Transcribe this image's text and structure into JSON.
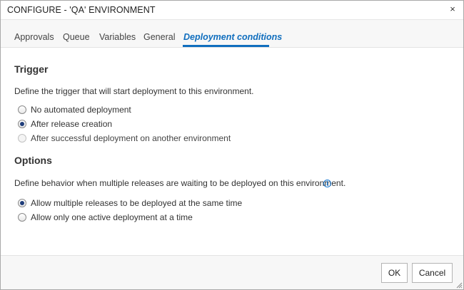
{
  "dialog": {
    "title": "CONFIGURE - 'QA' ENVIRONMENT",
    "close_glyph": "×"
  },
  "tabs": [
    {
      "label": "Approvals",
      "active": false
    },
    {
      "label": "Queue",
      "active": false
    },
    {
      "label": "Variables",
      "active": false
    },
    {
      "label": "General",
      "active": false
    },
    {
      "label": "Deployment conditions",
      "active": true
    }
  ],
  "trigger": {
    "heading": "Trigger",
    "description": "Define the trigger that will start deployment to this environment.",
    "options": [
      {
        "label": "No automated deployment",
        "checked": false,
        "disabled": false
      },
      {
        "label": "After release creation",
        "checked": true,
        "disabled": false
      },
      {
        "label": "After successful deployment on another environment",
        "checked": false,
        "disabled": true
      }
    ]
  },
  "options_section": {
    "heading": "Options",
    "description": "Define behavior when multiple releases are waiting to be deployed on this environment.",
    "info_icon": "info-icon",
    "info_glyph": "i",
    "options": [
      {
        "label": "Allow multiple releases to be deployed at the same time",
        "checked": true
      },
      {
        "label": "Allow only one active deployment at a time",
        "checked": false
      }
    ]
  },
  "footer": {
    "ok_label": "OK",
    "cancel_label": "Cancel"
  },
  "colors": {
    "accent": "#106ebe",
    "radio_dot": "#1f3d7a",
    "info": "#1c7cd5"
  }
}
